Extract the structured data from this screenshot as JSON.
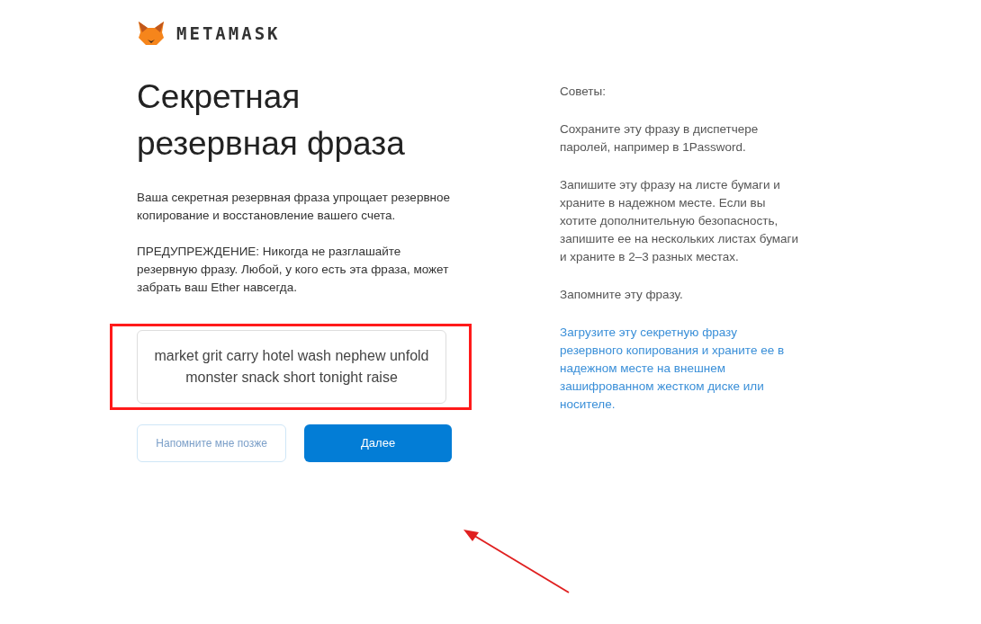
{
  "logo": {
    "wordmark": "METAMASK"
  },
  "title": "Секретная резервная фраза",
  "intro": "Ваша секретная резервная фраза упрощает резервное копирование и восстановление вашего счета.",
  "warning": "ПРЕДУПРЕЖДЕНИЕ: Никогда не разглашайте резервную фразу. Любой, у кого есть эта фраза, может забрать ваш Ether навсегда.",
  "phrase": "market grit carry hotel wash nephew unfold monster snack short tonight raise",
  "buttons": [
    {
      "label": "Напомните мне позже",
      "kind": "secondary"
    },
    {
      "label": "Далее",
      "kind": "primary"
    }
  ],
  "tips": {
    "heading": "Советы:",
    "items": [
      {
        "text": "Сохраните эту фразу в диспетчере паролей, например в 1Password.",
        "kind": "text"
      },
      {
        "text": "Запишите эту фразу на листе бумаги и храните в надежном месте. Если вы хотите дополнительную безопасность, запишите ее на нескольких листах бумаги и храните в 2–3 разных местах.",
        "kind": "text"
      },
      {
        "text": "Запомните эту фразу.",
        "kind": "text"
      },
      {
        "text": "Загрузите эту секретную фразу резервного копирования и храните ее в надежном месте на внешнем зашифрованном жестком диске или носителе.",
        "kind": "link"
      }
    ]
  }
}
